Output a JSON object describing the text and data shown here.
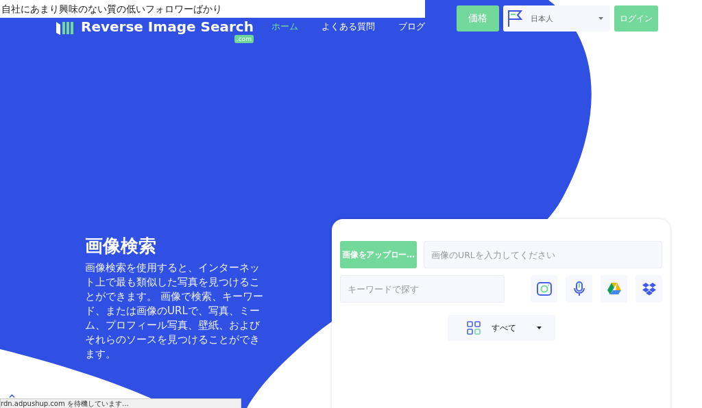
{
  "notice_bar": {
    "text": "自社にあまり興味のない質の低いフォロワーばかり"
  },
  "header": {
    "logo": {
      "name": "Reverse Image Search",
      "badge": ".com"
    },
    "nav": [
      {
        "label": "ホーム",
        "selected": true
      },
      {
        "label": "よくある質問",
        "selected": false
      },
      {
        "label": "ブログ",
        "selected": false
      }
    ],
    "pricing_button": "価格",
    "language_select": {
      "value": "日本人"
    },
    "login_button": "ログイン"
  },
  "hero": {
    "title": "画像検索",
    "description": "画像検索を使用すると、インターネット上で最も類似した写真を見つけることができます。 画像で検索、キーワード、または画像のURLで、写真、ミーム、プロフィール写真、壁紙、およびそれらのソースを見つけることができます。"
  },
  "search_card": {
    "upload_button": "画像をアップロー…",
    "url_field": {
      "placeholder": "画像のURLを入力してください"
    },
    "keyword_field": {
      "placeholder": "キーワードで探す"
    },
    "category_select": {
      "value": "すべて"
    }
  },
  "status_bar": {
    "text": "rdn.adpushup.com を待機しています…"
  }
}
